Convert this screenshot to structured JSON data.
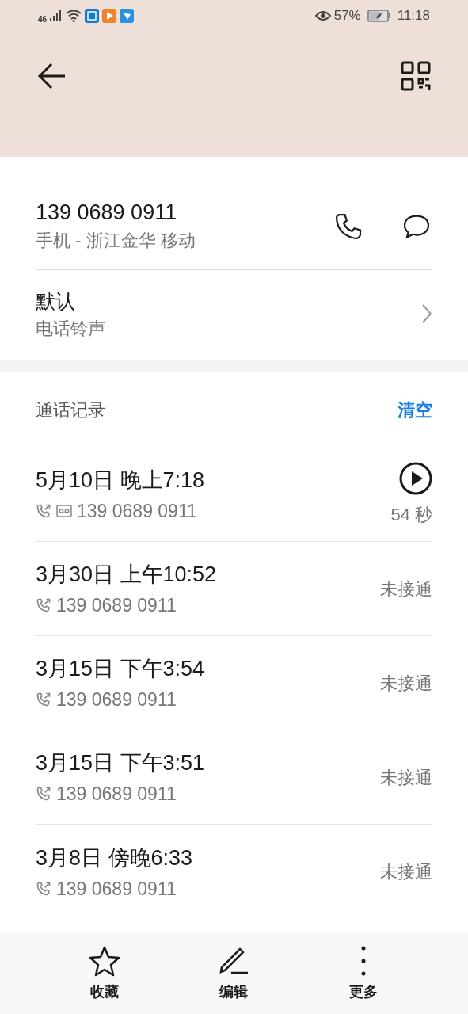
{
  "status_bar": {
    "network": "46",
    "battery": "57%",
    "time": "11:18"
  },
  "contact": {
    "number": "139 0689 0911",
    "detail": "手机 - 浙江金华 移动"
  },
  "ringtone": {
    "value": "默认",
    "label": "电话铃声"
  },
  "call_log": {
    "title": "通话记录",
    "clear": "清空",
    "entries": [
      {
        "kind": "recording",
        "date": "5月10日 晚上7:18",
        "number": "139 0689 0911",
        "voicemail": true,
        "result": "54 秒"
      },
      {
        "kind": "missed",
        "date": "3月30日 上午10:52",
        "number": "139 0689 0911",
        "voicemail": false,
        "result": "未接通"
      },
      {
        "kind": "missed",
        "date": "3月15日 下午3:54",
        "number": "139 0689 0911",
        "voicemail": false,
        "result": "未接通"
      },
      {
        "kind": "missed",
        "date": "3月15日 下午3:51",
        "number": "139 0689 0911",
        "voicemail": false,
        "result": "未接通"
      },
      {
        "kind": "missed",
        "date": "3月8日 傍晚6:33",
        "number": "139 0689 0911",
        "voicemail": false,
        "result": "未接通"
      }
    ]
  },
  "bottom_bar": [
    {
      "kind": "favorite",
      "label": "收藏"
    },
    {
      "kind": "edit",
      "label": "编辑"
    },
    {
      "kind": "more",
      "label": "更多"
    }
  ]
}
